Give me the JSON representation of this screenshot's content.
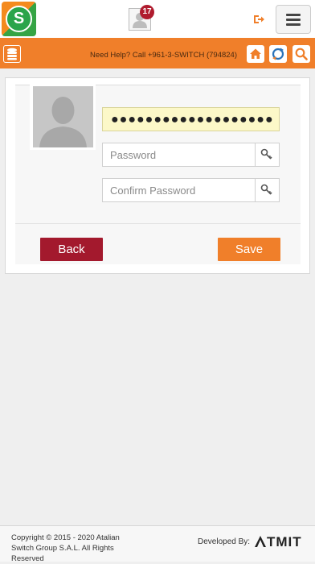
{
  "header": {
    "notification_count": "17",
    "logo_letter": "S"
  },
  "toolbar": {
    "help_text": "Need Help? Call +961-3-SWITCH (794824)"
  },
  "form": {
    "current_password_value": "●●●●●●●●●●●●●●●●●●●",
    "password_placeholder": "Password",
    "confirm_placeholder": "Confirm Password",
    "back_label": "Back",
    "save_label": "Save"
  },
  "footer": {
    "copyright": "Copyright © 2015 - 2020 Atalian Switch Group S.A.L. All Rights Reserved",
    "developed_by": "Developed By:",
    "developer": "TMIT"
  },
  "colors": {
    "accent": "#f07f2a",
    "back_button": "#a3192d",
    "badge": "#b01c2e"
  },
  "icons": [
    "logo-icon",
    "user-icon",
    "logout-icon",
    "menu-icon",
    "database-icon",
    "home-icon",
    "refresh-icon",
    "search-icon",
    "key-icon"
  ]
}
